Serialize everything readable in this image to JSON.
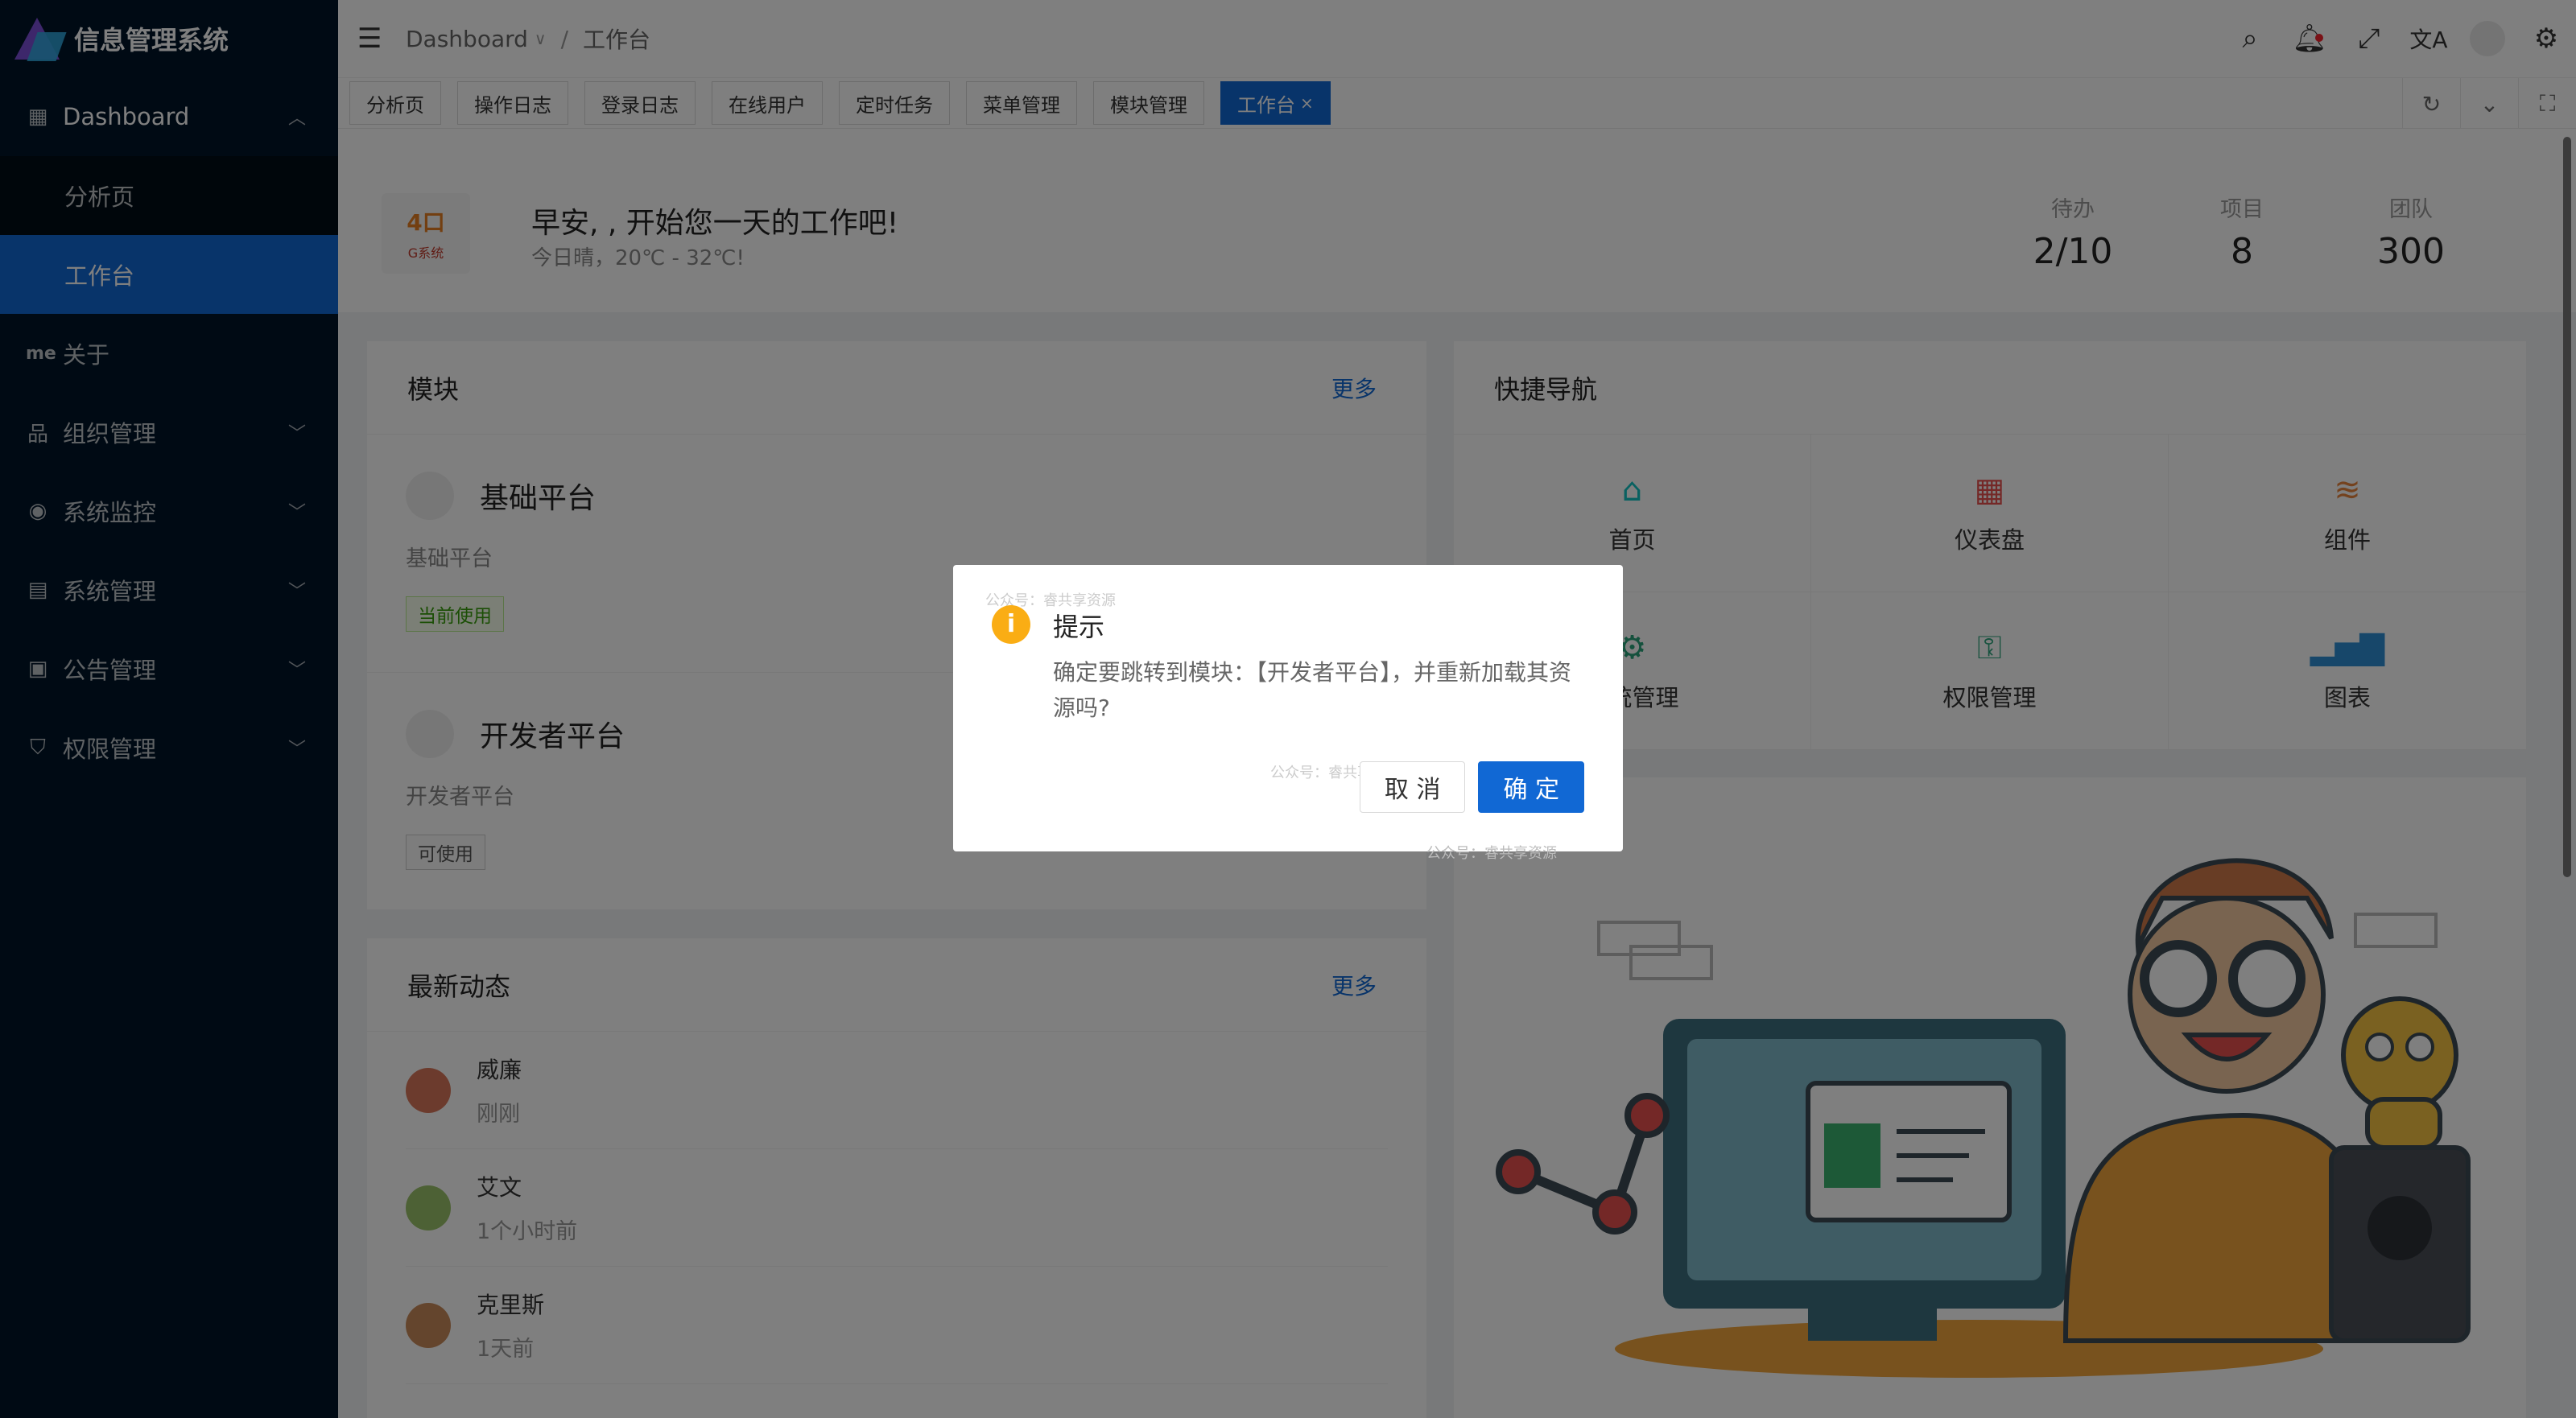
{
  "app": {
    "title": "信息管理系统"
  },
  "sidebar": {
    "items": [
      {
        "label": "Dashboard",
        "icon": "grid-icon",
        "expanded": true
      },
      {
        "label": "分析页"
      },
      {
        "label": "工作台",
        "active": true
      },
      {
        "label": "关于",
        "icon_text": "me"
      },
      {
        "label": "组织管理",
        "icon": "org-icon"
      },
      {
        "label": "系统监控",
        "icon": "eye-icon"
      },
      {
        "label": "系统管理",
        "icon": "settings-panel-icon"
      },
      {
        "label": "公告管理",
        "icon": "notice-icon"
      },
      {
        "label": "权限管理",
        "icon": "shield-icon"
      }
    ]
  },
  "header": {
    "breadcrumb": [
      "Dashboard",
      "工作台"
    ]
  },
  "tabs": [
    {
      "label": "分析页"
    },
    {
      "label": "操作日志"
    },
    {
      "label": "登录日志"
    },
    {
      "label": "在线用户"
    },
    {
      "label": "定时任务"
    },
    {
      "label": "菜单管理"
    },
    {
      "label": "模块管理"
    },
    {
      "label": "工作台",
      "active": true,
      "close": "×"
    }
  ],
  "welcome": {
    "avatar_text": "4口",
    "avatar_sub": "G系统",
    "greeting": "早安, , 开始您一天的工作吧!",
    "weather": "今日晴，20℃ - 32℃!",
    "stats": [
      {
        "label": "待办",
        "value": "2/10"
      },
      {
        "label": "项目",
        "value": "8"
      },
      {
        "label": "团队",
        "value": "300"
      }
    ]
  },
  "modules": {
    "title": "模块",
    "more": "更多",
    "items": [
      {
        "name": "基础平台",
        "desc": "基础平台",
        "tag": "当前使用"
      },
      {
        "name": "开发者平台",
        "desc": "开发者平台",
        "tag": "可使用"
      }
    ]
  },
  "quicknav": {
    "title": "快捷导航",
    "items": [
      {
        "label": "首页",
        "icon": "home-icon",
        "color": "#13c2c2"
      },
      {
        "label": "仪表盘",
        "icon": "dashboard-icon",
        "color": "#e8504f"
      },
      {
        "label": "组件",
        "icon": "layers-icon",
        "color": "#e8843c"
      },
      {
        "label": "系统管理",
        "icon": "gear-icon",
        "color": "#2aa37a"
      },
      {
        "label": "权限管理",
        "icon": "key-icon",
        "color": "#2aa37a"
      },
      {
        "label": "图表",
        "icon": "bar-chart-icon",
        "color": "#2f8fd4"
      }
    ]
  },
  "feed": {
    "title": "最新动态",
    "more": "更多",
    "items": [
      {
        "name": "威廉",
        "time": "刚刚"
      },
      {
        "name": "艾文",
        "time": "1个小时前"
      },
      {
        "name": "克里斯",
        "time": "1天前"
      }
    ]
  },
  "dialog": {
    "title": "提示",
    "message": "确定要跳转到模块：【开发者平台】，并重新加载其资源吗?",
    "cancel": "取 消",
    "ok": "确 定",
    "watermark": "公众号：睿共享资源"
  },
  "colors": {
    "sidebar_bg": "#001529",
    "primary": "#1168d4",
    "warning": "#faad14"
  }
}
